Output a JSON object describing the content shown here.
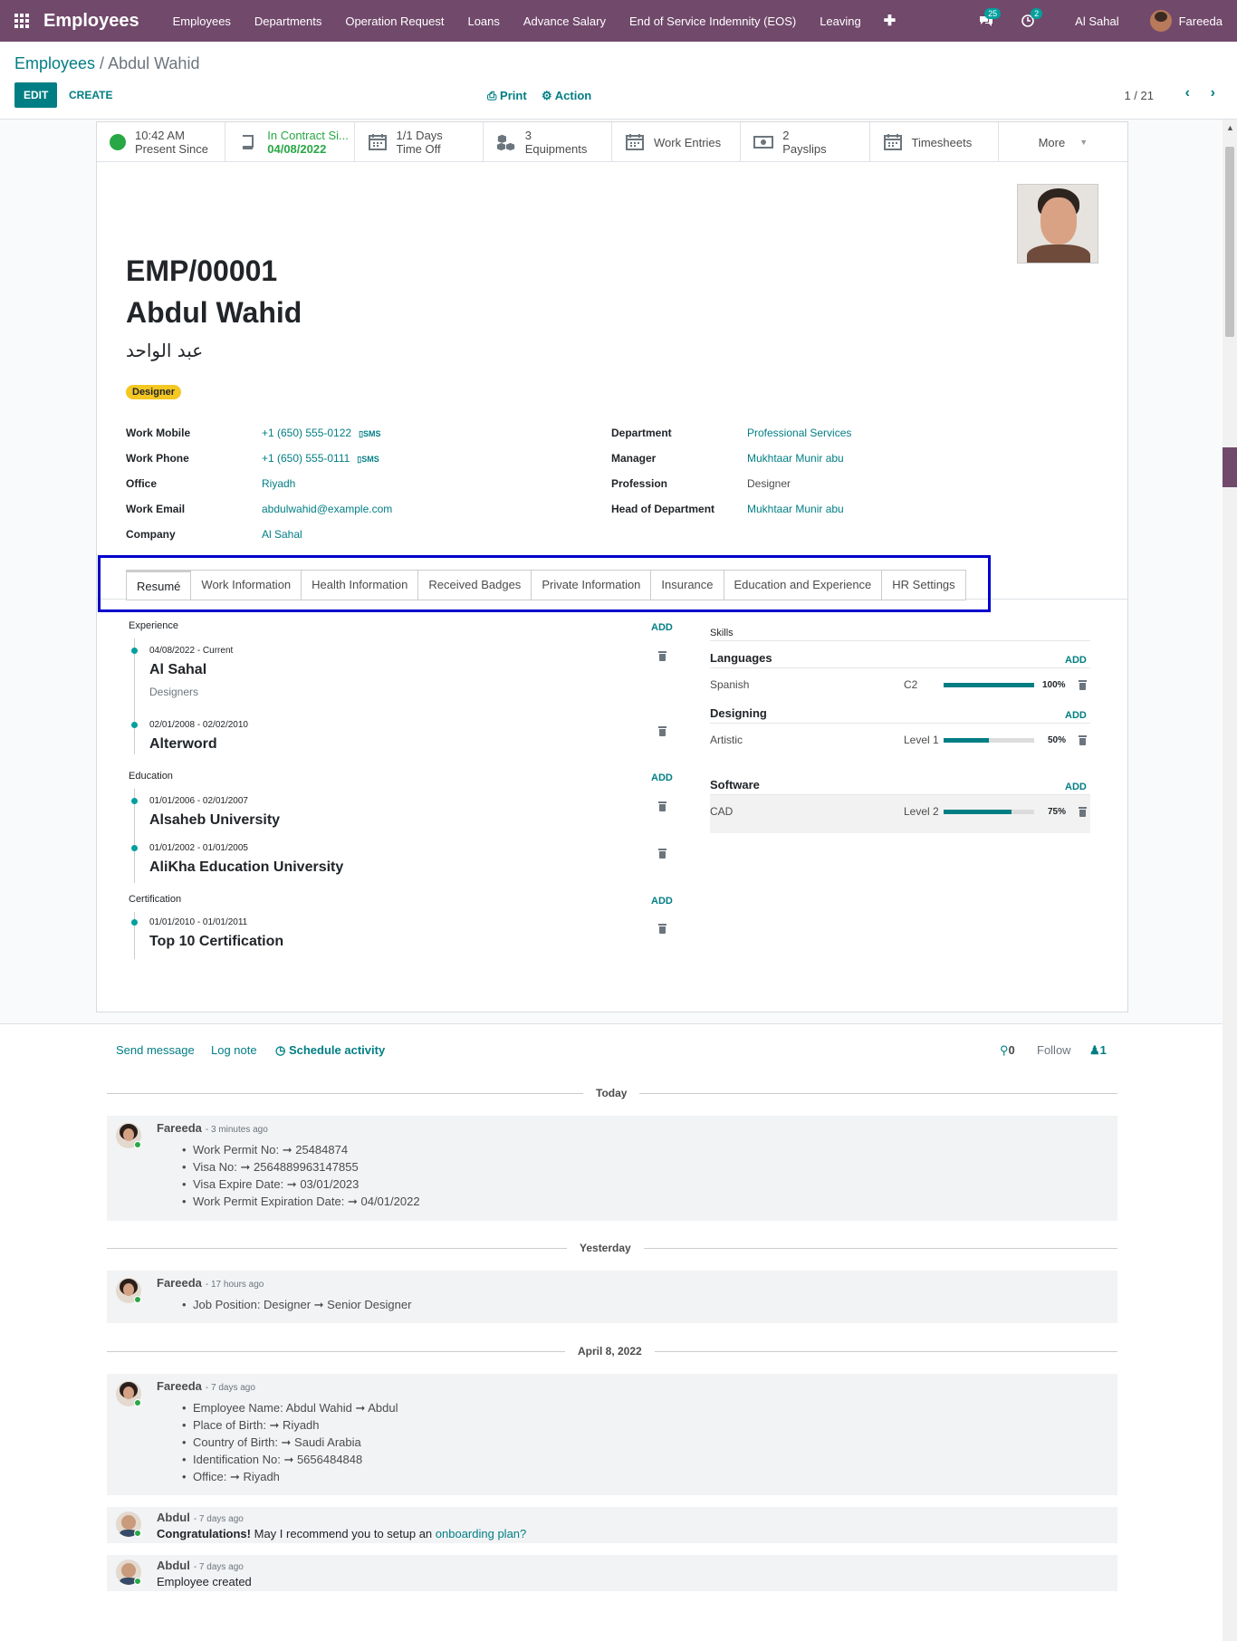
{
  "navbar": {
    "app_title": "Employees",
    "menu": [
      "Employees",
      "Departments",
      "Operation Request",
      "Loans",
      "Advance Salary",
      "End of Service Indemnity (EOS)",
      "Leaving"
    ],
    "messages_count": "25",
    "activities_count": "2",
    "company": "Al Sahal",
    "user": "Fareeda"
  },
  "control": {
    "breadcrumb_root": "Employees",
    "breadcrumb_sep": " / ",
    "breadcrumb_current": "Abdul Wahid",
    "edit_label": "EDIT",
    "create_label": "CREATE",
    "print_label": "Print",
    "action_label": "Action",
    "pager": "1 / 21"
  },
  "stats": {
    "presence": {
      "line1": "10:42 AM",
      "line2": "Present Since"
    },
    "contract": {
      "line1": "In Contract Si...",
      "line2": "04/08/2022"
    },
    "time_off": {
      "line1": "1/1 Days",
      "line2": "Time Off"
    },
    "equipments": {
      "line1": "3",
      "line2": "Equipments"
    },
    "work_entries": {
      "line1": "Work Entries"
    },
    "payslips": {
      "line1": "2",
      "line2": "Payslips"
    },
    "timesheets": {
      "line1": "Timesheets"
    },
    "more": {
      "line1": "More"
    }
  },
  "employee": {
    "id": "EMP/00001",
    "name": "Abdul Wahid",
    "arabic_name": "عبد الواحد",
    "tag": "Designer"
  },
  "fields": {
    "work_mobile_label": "Work Mobile",
    "work_mobile": "+1 (650) 555-0122",
    "work_phone_label": "Work Phone",
    "work_phone": "+1 (650) 555-0111",
    "sms_label": "SMS",
    "office_label": "Office",
    "office": "Riyadh",
    "work_email_label": "Work Email",
    "work_email": "abdulwahid@example.com",
    "company_label": "Company",
    "company": "Al Sahal",
    "department_label": "Department",
    "department": "Professional Services",
    "manager_label": "Manager",
    "manager": "Mukhtaar Munir abu",
    "profession_label": "Profession",
    "profession": "Designer",
    "head_label": "Head of Department",
    "head": "Mukhtaar Munir abu"
  },
  "tabs": [
    "Resumé",
    "Work Information",
    "Health Information",
    "Received Badges",
    "Private Information",
    "Insurance",
    "Education and Experience",
    "HR Settings"
  ],
  "resume": {
    "add_label": "ADD",
    "experience_title": "Experience",
    "education_title": "Education",
    "certification_title": "Certification",
    "exp1": {
      "date": "04/08/2022 - Current",
      "title": "Al Sahal",
      "sub": "Designers"
    },
    "exp2": {
      "date": "02/01/2008 - 02/02/2010",
      "title": "Alterword"
    },
    "edu1": {
      "date": "01/01/2006 - 02/01/2007",
      "title": "Alsaheb University"
    },
    "edu2": {
      "date": "01/01/2002 - 01/01/2005",
      "title": "AliKha Education University"
    },
    "cert1": {
      "date": "01/01/2010 - 01/01/2011",
      "title": "Top 10 Certification"
    }
  },
  "skills": {
    "title": "Skills",
    "add_label": "ADD",
    "languages": {
      "group": "Languages",
      "name": "Spanish",
      "level": "C2",
      "pct_label": "100%",
      "progress": 100
    },
    "designing": {
      "group": "Designing",
      "name": "Artistic",
      "level": "Level 1",
      "pct_label": "50%",
      "progress": 50
    },
    "software": {
      "group": "Software",
      "name": "CAD",
      "level": "Level 2",
      "pct_label": "75%",
      "progress": 75
    }
  },
  "chatter": {
    "send_message": "Send message",
    "log_note": "Log note",
    "schedule_activity": "Schedule activity",
    "attachments": "0",
    "follow": "Follow",
    "followers": "1",
    "today": "Today",
    "yesterday": "Yesterday",
    "april": "April 8, 2022",
    "msg1": {
      "author": "Fareeda",
      "ago": "- 3 minutes ago",
      "lines": [
        "Work Permit No: ➞ 25484874",
        "Visa No: ➞ 2564889963147855",
        "Visa Expire Date: ➞ 03/01/2023",
        "Work Permit Expiration Date: ➞ 04/01/2022"
      ]
    },
    "msg2": {
      "author": "Fareeda",
      "ago": "- 17 hours ago",
      "lines": [
        "Job Position: Designer ➞ Senior Designer"
      ]
    },
    "msg3": {
      "author": "Fareeda",
      "ago": "- 7 days ago",
      "lines": [
        "Employee Name: Abdul Wahid ➞ Abdul",
        "Place of Birth: ➞ Riyadh",
        "Country of Birth: ➞ Saudi Arabia",
        "Identification No: ➞ 5656484848",
        "Office: ➞ Riyadh"
      ]
    },
    "msg4": {
      "author": "Abdul",
      "ago": "- 7 days ago",
      "bold": "Congratulations!",
      "text": " May I recommend you to setup an ",
      "link": "onboarding plan?"
    },
    "msg5": {
      "author": "Abdul",
      "ago": "- 7 days ago",
      "text": "Employee created"
    }
  }
}
